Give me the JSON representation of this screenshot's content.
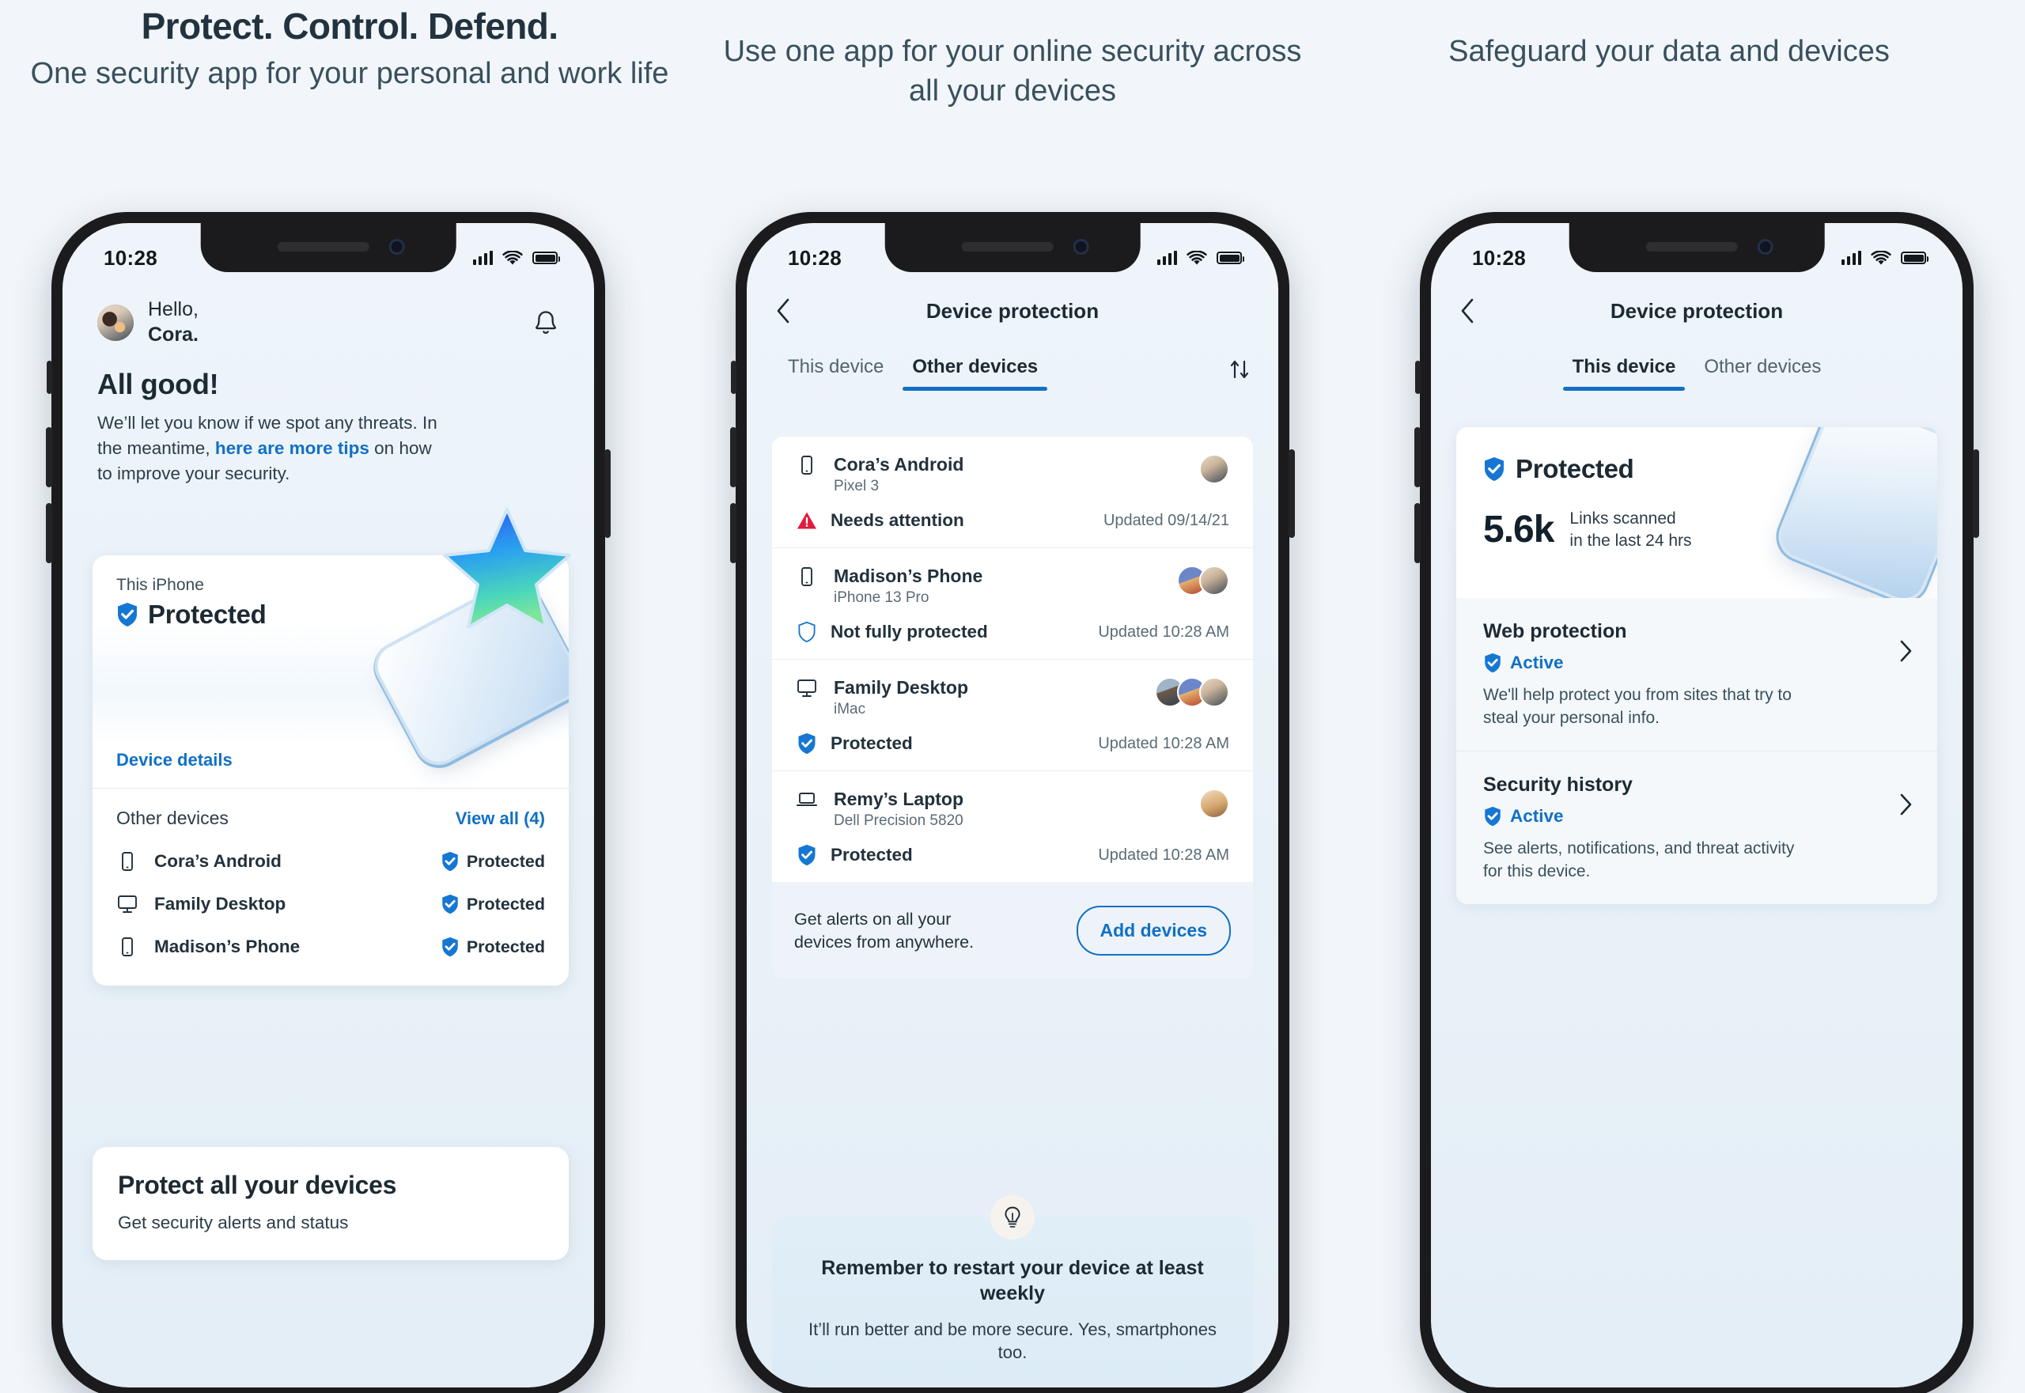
{
  "headers": [
    {
      "title": "Protect. Control. Defend.",
      "subtitle": "One security app for your personal and work life"
    },
    {
      "title": "",
      "subtitle": "Use one app for your online security across all your devices"
    },
    {
      "title": "",
      "subtitle": "Safeguard your data and devices"
    }
  ],
  "status_bar": {
    "time": "10:28",
    "signal_icon": "signal-bars-icon",
    "wifi_icon": "wifi-icon",
    "battery_icon": "battery-full-icon"
  },
  "phone1": {
    "greeting_line1": "Hello,",
    "greeting_line2": "Cora.",
    "notification_icon": "bell-icon",
    "avatar_name": "avatar",
    "headline": "All good!",
    "body_part1": "We’ll let you know if we spot any threats. In the meantime, ",
    "body_link": "here are more tips",
    "body_part2": " on how to improve your security.",
    "card": {
      "device_label": "This iPhone",
      "status": "Protected",
      "details_link": "Device details",
      "others_label": "Other devices",
      "view_all": "View all (4)",
      "devices": [
        {
          "name": "Cora’s Android",
          "icon": "phone-icon",
          "status": "Protected"
        },
        {
          "name": "Family Desktop",
          "icon": "desktop-icon",
          "status": "Protected"
        },
        {
          "name": "Madison’s Phone",
          "icon": "phone-icon",
          "status": "Protected"
        }
      ]
    },
    "promo": {
      "title": "Protect all your devices",
      "body": "Get security alerts and status"
    }
  },
  "phone2": {
    "back_icon": "chevron-left-icon",
    "title": "Device protection",
    "tabs": [
      {
        "label": "This device",
        "active": false
      },
      {
        "label": "Other devices",
        "active": true
      }
    ],
    "sort_icon": "sort-arrows-icon",
    "devices": [
      {
        "name": "Cora’s Android",
        "model": "Pixel 3",
        "icon": "phone-icon",
        "status": "Needs attention",
        "status_icon": "warning-triangle-icon",
        "updated": "Updated 09/14/21",
        "faces": 1
      },
      {
        "name": "Madison’s Phone",
        "model": "iPhone 13 Pro",
        "icon": "phone-icon",
        "status": "Not fully protected",
        "status_icon": "shield-outline-icon",
        "updated": "Updated 10:28 AM",
        "faces": 2
      },
      {
        "name": "Family Desktop",
        "model": "iMac",
        "icon": "desktop-icon",
        "status": "Protected",
        "status_icon": "shield-check-icon",
        "updated": "Updated 10:28 AM",
        "faces": 3
      },
      {
        "name": "Remy’s Laptop",
        "model": "Dell Precision 5820",
        "icon": "laptop-icon",
        "status": "Protected",
        "status_icon": "shield-check-icon",
        "updated": "Updated 10:28 AM",
        "faces": 1
      }
    ],
    "add_bar": {
      "text": "Get alerts on all your devices from anywhere.",
      "button": "Add devices"
    },
    "tip": {
      "icon": "lightbulb-icon",
      "title": "Remember to restart your device at least weekly",
      "body": "It’ll run better and be more secure. Yes, smartphones too."
    }
  },
  "phone3": {
    "back_icon": "chevron-left-icon",
    "title": "Device protection",
    "tabs": [
      {
        "label": "This device",
        "active": true
      },
      {
        "label": "Other devices",
        "active": false
      }
    ],
    "hero": {
      "status": "Protected",
      "stat_value": "5.6k",
      "stat_desc_line1": "Links scanned",
      "stat_desc_line2": "in the last 24 hrs"
    },
    "sections": [
      {
        "title": "Web protection",
        "state": "Active",
        "desc": "We'll help protect you from sites that try to steal your personal info.",
        "chevron": "chevron-right-icon"
      },
      {
        "title": "Security history",
        "state": "Active",
        "desc": "See alerts, notifications, and threat activity for this device.",
        "chevron": "chevron-right-icon"
      }
    ]
  },
  "colors": {
    "accent": "#1170c4",
    "danger": "#e01b3c",
    "text": "#1d2a33",
    "bg": "#f2f6fa"
  }
}
